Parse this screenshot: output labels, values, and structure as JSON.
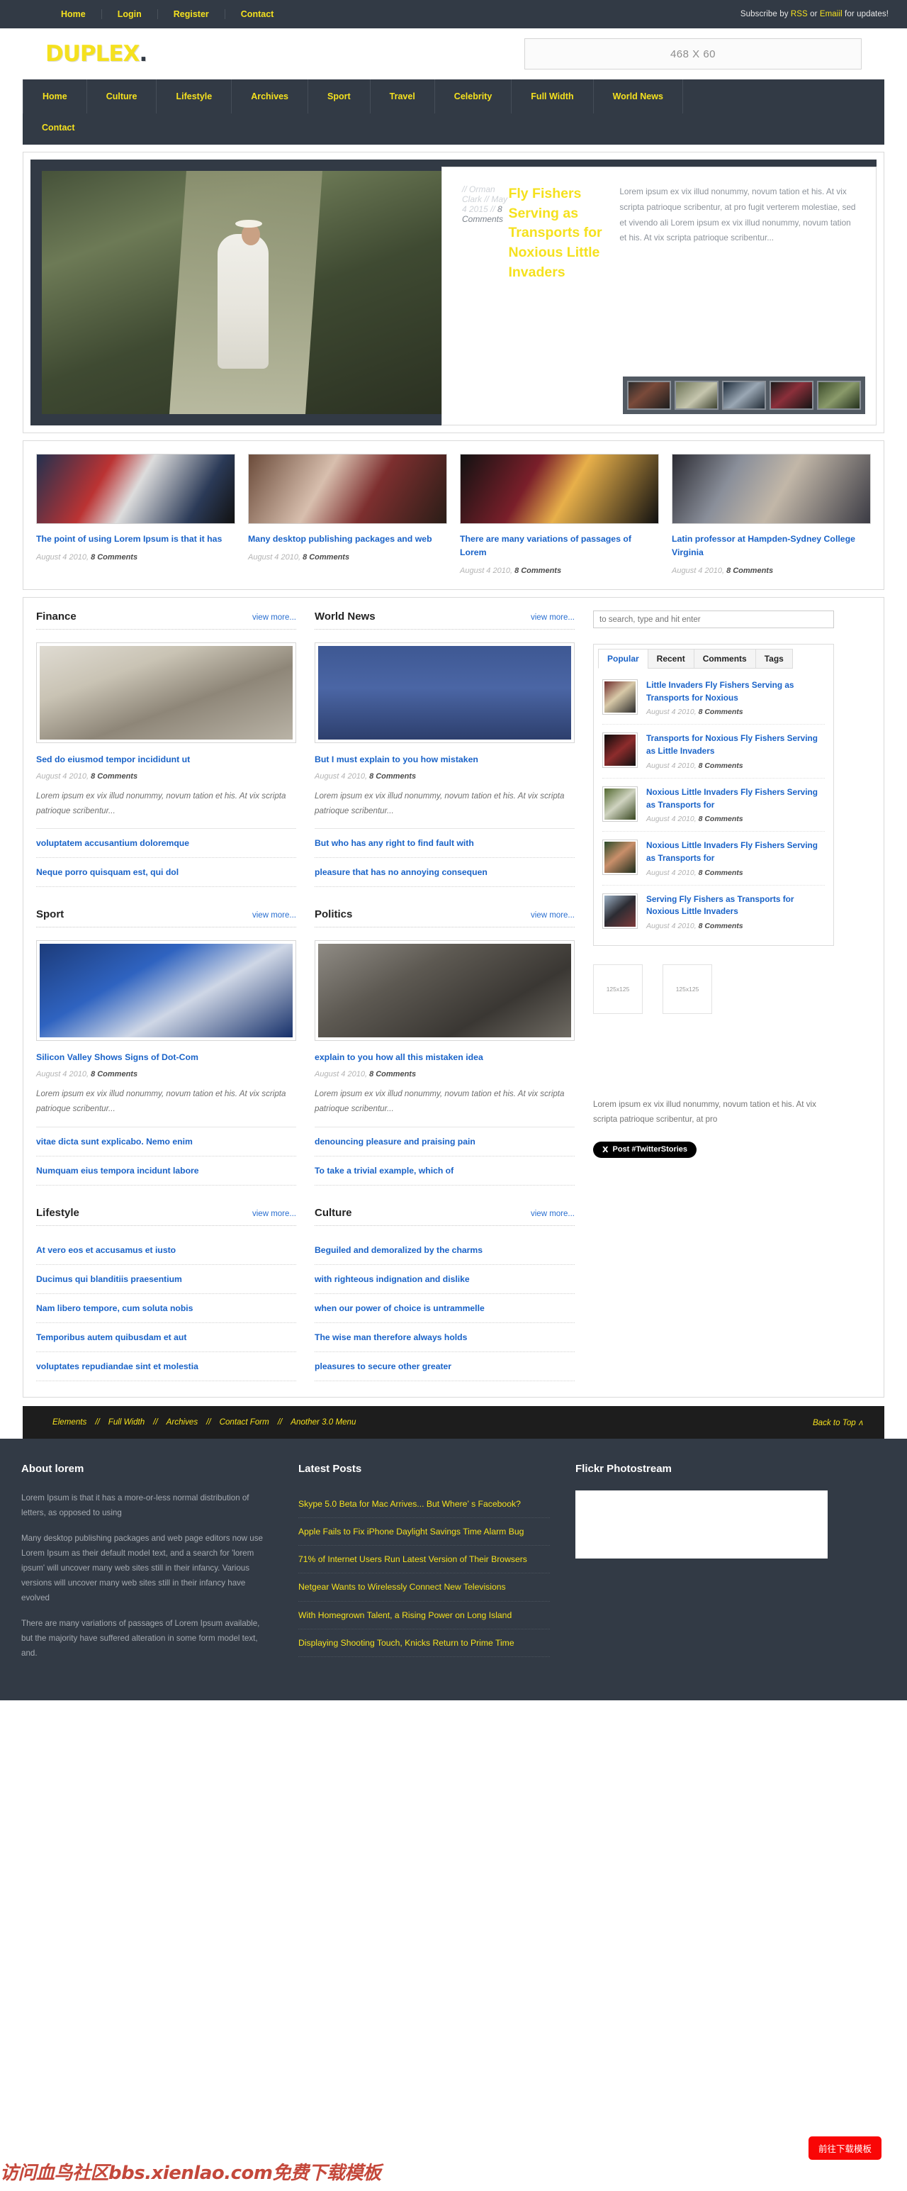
{
  "topbar": {
    "nav": [
      {
        "label": "Home"
      },
      {
        "label": "Login"
      },
      {
        "label": "Register"
      },
      {
        "label": "Contact"
      }
    ],
    "subscribe_prefix": "Subscribe by ",
    "subscribe_rss": "RSS",
    "subscribe_mid": " or ",
    "subscribe_email": "Emaiil",
    "subscribe_suffix": " for updates!"
  },
  "header": {
    "logo": "DUPLEX",
    "logo_dot": ".",
    "banner": "468 X 60"
  },
  "mainnav": {
    "row1": [
      {
        "label": "Home"
      },
      {
        "label": "Culture"
      },
      {
        "label": "Lifestyle"
      },
      {
        "label": "Archives"
      },
      {
        "label": "Sport"
      },
      {
        "label": "Travel"
      },
      {
        "label": "Celebrity"
      },
      {
        "label": "Full Width"
      },
      {
        "label": "World News"
      }
    ],
    "row2": [
      {
        "label": "Contact"
      }
    ]
  },
  "slider": {
    "meta_author": "// Orman Clark // May 4 2015 // ",
    "meta_comments": "8 Comments",
    "title": "Fly Fishers Serving as Transports for Noxious Little Invaders",
    "excerpt": "Lorem ipsum ex vix illud nonummy, novum tation et his. At vix scripta patrioque scribentur, at pro fugit verterem molestiae, sed et vivendo ali Lorem ipsum ex vix illud nonummy, novum tation et his. At vix scripta patrioque scribentur..."
  },
  "featured": [
    {
      "title": "The point of using Lorem Ipsum is that it has",
      "date": "August 4 2010, ",
      "comments": "8 Comments"
    },
    {
      "title": "Many desktop publishing packages and web",
      "date": "August 4 2010, ",
      "comments": "8 Comments"
    },
    {
      "title": "There are many variations of passages of Lorem",
      "date": "August 4 2010, ",
      "comments": "8 Comments"
    },
    {
      "title": "Latin professor at Hampden-Sydney College Virginia",
      "date": "August 4 2010, ",
      "comments": "8 Comments"
    }
  ],
  "sections": {
    "finance": {
      "title": "Finance",
      "view_more": "view more...",
      "post_title": "Sed do eiusmod tempor incididunt ut",
      "post_date": "August 4 2010, ",
      "post_comments": "8 Comments",
      "post_excerpt": "Lorem ipsum ex vix illud nonummy, novum tation et his. At vix scripta patrioque scribentur...",
      "links": [
        "voluptatem accusantium doloremque",
        "Neque porro quisquam est, qui dol"
      ]
    },
    "world_news": {
      "title": "World News",
      "view_more": "view more...",
      "post_title": "But I must explain to you how mistaken",
      "post_date": "August 4 2010, ",
      "post_comments": "8 Comments",
      "post_excerpt": "Lorem ipsum ex vix illud nonummy, novum tation et his. At vix scripta patrioque scribentur...",
      "links": [
        "But who has any right to find fault with",
        "pleasure that has no annoying consequen"
      ]
    },
    "sport": {
      "title": "Sport",
      "view_more": "view more...",
      "post_title": "Silicon Valley Shows Signs of Dot-Com",
      "post_date": "August 4 2010, ",
      "post_comments": "8 Comments",
      "post_excerpt": "Lorem ipsum ex vix illud nonummy, novum tation et his. At vix scripta patrioque scribentur...",
      "links": [
        "vitae dicta sunt explicabo. Nemo enim",
        "Numquam eius tempora incidunt labore"
      ]
    },
    "politics": {
      "title": "Politics",
      "view_more": "view more...",
      "post_title": "explain to you how all this mistaken idea",
      "post_date": "August 4 2010, ",
      "post_comments": "8 Comments",
      "post_excerpt": "Lorem ipsum ex vix illud nonummy, novum tation et his. At vix scripta patrioque scribentur...",
      "links": [
        "denouncing pleasure and praising pain",
        "To take a trivial example, which of"
      ]
    },
    "lifestyle": {
      "title": "Lifestyle",
      "view_more": "view more...",
      "links": [
        "At vero eos et accusamus et iusto",
        "Ducimus qui blanditiis praesentium",
        "Nam libero tempore, cum soluta nobis",
        "Temporibus autem quibusdam et aut",
        "voluptates repudiandae sint et molestia"
      ]
    },
    "culture": {
      "title": "Culture",
      "view_more": "view more...",
      "links": [
        "Beguiled and demoralized by the charms",
        "with righteous indignation and dislike",
        "when our power of choice is untrammelle",
        "The wise man therefore always holds",
        "pleasures to secure other greater"
      ]
    }
  },
  "sidebar": {
    "search_placeholder": "to search, type and hit enter",
    "tabs": [
      {
        "label": "Popular",
        "active": true
      },
      {
        "label": "Recent",
        "active": false
      },
      {
        "label": "Comments",
        "active": false
      },
      {
        "label": "Tags",
        "active": false
      }
    ],
    "popular": [
      {
        "title": "Little Invaders Fly Fishers Serving as Transports for Noxious",
        "date": "August 4 2010, ",
        "comments": "8 Comments"
      },
      {
        "title": "Transports for Noxious Fly Fishers Serving as Little Invaders",
        "date": "August 4 2010, ",
        "comments": "8 Comments"
      },
      {
        "title": "Noxious Little Invaders Fly Fishers Serving as Transports for",
        "date": "August 4 2010, ",
        "comments": "8 Comments"
      },
      {
        "title": "Noxious Little Invaders Fly Fishers Serving as Transports for",
        "date": "August 4 2010, ",
        "comments": "8 Comments"
      },
      {
        "title": "Serving Fly Fishers as Transports for Noxious Little Invaders",
        "date": "August 4 2010, ",
        "comments": "8 Comments"
      }
    ],
    "ads": [
      "125x125",
      "125x125"
    ],
    "text": "Lorem ipsum ex vix illud nonummy, novum tation et his. At vix scripta patrioque scribentur, at pro",
    "tweet_button": "Post #TwitterStories",
    "tweet_icon": "X"
  },
  "footnav": {
    "links": [
      {
        "label": "Elements"
      },
      {
        "label": "Full Width"
      },
      {
        "label": "Archives"
      },
      {
        "label": "Contact Form"
      },
      {
        "label": "Another 3.0 Menu"
      }
    ],
    "separator": "//",
    "back_to_top": "Back to Top",
    "back_to_top_arrow": "ʌ"
  },
  "footer": {
    "about": {
      "title": "About lorem",
      "paragraphs": [
        "Lorem Ipsum is that it has a more-or-less normal distribution of letters, as opposed to using",
        "Many desktop publishing packages and web page editors now use Lorem Ipsum as their default model text, and a search for 'lorem ipsum' will uncover many web sites still in their infancy. Various versions will uncover many web sites still in their infancy have evolved",
        "There are many variations of passages of Lorem Ipsum available, but the majority have suffered alteration in some form model text, and."
      ]
    },
    "latest": {
      "title": "Latest Posts",
      "items": [
        "Skype 5.0 Beta for Mac Arrives... But Where’ s Facebook?",
        "Apple Fails to Fix iPhone Daylight Savings Time Alarm Bug",
        "71% of Internet Users Run Latest Version of Their Browsers",
        "Netgear Wants to Wirelessly Connect New Televisions",
        "With Homegrown Talent, a Rising Power on Long Island",
        "Displaying Shooting Touch, Knicks Return to Prime Time"
      ]
    },
    "flickr": {
      "title": "Flickr Photostream"
    }
  },
  "overlay": {
    "watermark": "访问血鸟社区bbs.xienlao.com免费下载模板",
    "download_button": "前往下载模板"
  }
}
